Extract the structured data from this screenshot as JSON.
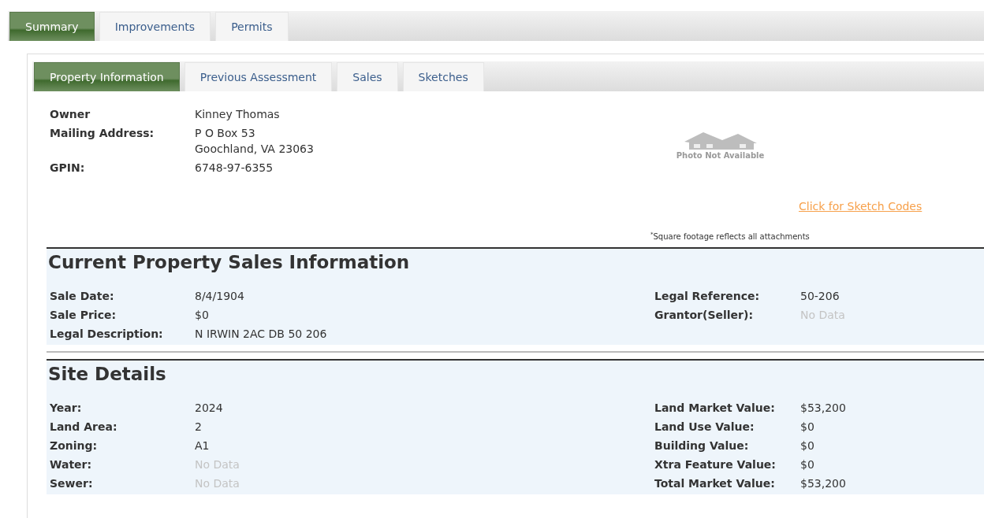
{
  "main_tabs": [
    {
      "label": "Summary",
      "selected": true
    },
    {
      "label": "Improvements",
      "selected": false
    },
    {
      "label": "Permits",
      "selected": false
    }
  ],
  "sub_tabs": [
    {
      "label": "Property Information",
      "selected": true
    },
    {
      "label": "Previous Assessment",
      "selected": false
    },
    {
      "label": "Sales",
      "selected": false
    },
    {
      "label": "Sketches",
      "selected": false
    }
  ],
  "owner_info": [
    {
      "label": "Owner",
      "lines": [
        "Kinney Thomas"
      ]
    },
    {
      "label": "Mailing Address:",
      "lines": [
        "P O Box 53",
        "Goochland, VA 23063"
      ]
    },
    {
      "label": "GPIN:",
      "lines": [
        "6748-97-6355"
      ]
    }
  ],
  "photo": {
    "caption": "Photo Not Available"
  },
  "sketch_link": "Click for Sketch Codes",
  "footnote": "$^{*}$Square footage reflects all attachments",
  "sections": [
    {
      "title": "Current Property Sales Information",
      "rows": [
        {
          "left": {
            "label": "Sale Date:",
            "value": "8/4/1904",
            "empty": false
          },
          "right": {
            "label": "Legal Reference:",
            "value": "50-206",
            "empty": false
          }
        },
        {
          "left": {
            "label": "Sale Price:",
            "value": "$0",
            "empty": false
          },
          "right": {
            "label": "Grantor(Seller):",
            "value": "No Data",
            "empty": true
          }
        },
        {
          "left": {
            "label": "Legal Description:",
            "value": "N IRWIN 2AC DB 50 206",
            "empty": false
          }
        }
      ]
    },
    {
      "title": "Site Details",
      "rows": [
        {
          "left": {
            "label": "Year:",
            "value": "2024",
            "empty": false
          },
          "right": {
            "label": "Land Market Value:",
            "value": "$53,200",
            "empty": false
          }
        },
        {
          "left": {
            "label": "Land Area:",
            "value": "2",
            "empty": false
          },
          "right": {
            "label": "Land Use Value:",
            "value": "$0",
            "empty": false
          }
        },
        {
          "left": {
            "label": "Zoning:",
            "value": "A1",
            "empty": false
          },
          "right": {
            "label": "Building Value:",
            "value": "$0",
            "empty": false
          }
        },
        {
          "left": {
            "label": "Water:",
            "value": "No Data",
            "empty": true
          },
          "right": {
            "label": "Xtra Feature Value:",
            "value": "$0",
            "empty": false
          }
        },
        {
          "left": {
            "label": "Sewer:",
            "value": "No Data",
            "empty": true
          },
          "right": {
            "label": "Total Market Value:",
            "value": "$53,200",
            "empty": false
          }
        }
      ]
    }
  ]
}
